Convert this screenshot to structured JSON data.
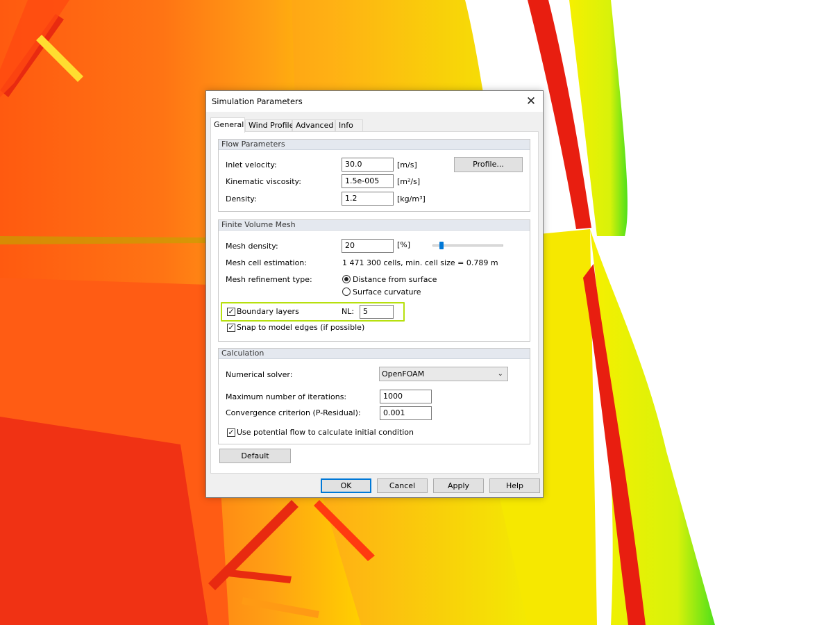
{
  "dialog": {
    "title": "Simulation Parameters",
    "close_symbol": "✕"
  },
  "tabs": [
    {
      "label": "General",
      "active": true
    },
    {
      "label": "Wind Profile",
      "active": false
    },
    {
      "label": "Advanced",
      "active": false
    },
    {
      "label": "Info",
      "active": false
    }
  ],
  "flow_parameters": {
    "header": "Flow Parameters",
    "inlet_velocity": {
      "label": "Inlet velocity:",
      "value": "30.0",
      "unit": "[m/s]"
    },
    "kinematic_viscosity": {
      "label": "Kinematic viscosity:",
      "value": "1.5e-005",
      "unit": "[m²/s]"
    },
    "density": {
      "label": "Density:",
      "value": "1.2",
      "unit": "[kg/m³]"
    },
    "profile_button": "Profile..."
  },
  "mesh": {
    "header": "Finite Volume Mesh",
    "density": {
      "label": "Mesh density:",
      "value": "20",
      "unit": "[%]",
      "slider_fraction": 0.13
    },
    "cell_estimation": {
      "label": "Mesh cell estimation:",
      "value": "1 471 300 cells, min. cell size = 0.789 m"
    },
    "refinement": {
      "label": "Mesh refinement type:",
      "options": [
        {
          "label": "Distance from surface",
          "checked": true
        },
        {
          "label": "Surface curvature",
          "checked": false
        }
      ]
    },
    "boundary_layers": {
      "label": "Boundary layers",
      "checked": true,
      "nl_label": "NL:",
      "nl_value": "5"
    },
    "snap_edges": {
      "label": "Snap to model edges (if possible)",
      "checked": true
    }
  },
  "calculation": {
    "header": "Calculation",
    "solver": {
      "label": "Numerical solver:",
      "value": "OpenFOAM"
    },
    "max_iterations": {
      "label": "Maximum number of iterations:",
      "value": "1000"
    },
    "convergence": {
      "label": "Convergence criterion (P-Residual):",
      "value": "0.001"
    },
    "potential_flow": {
      "label": "Use potential flow to calculate initial condition",
      "checked": true
    }
  },
  "buttons": {
    "default": "Default",
    "ok": "OK",
    "cancel": "Cancel",
    "apply": "Apply",
    "help": "Help"
  },
  "colors": {
    "accent": "#0078d7",
    "highlight": "#b7e00e",
    "bg_red": "#ee2a12",
    "bg_orange": "#ff7a12",
    "bg_yellow": "#f4f000",
    "bg_green": "#52e31a"
  },
  "icons": {
    "check": "✓",
    "chevron": "⌄"
  }
}
